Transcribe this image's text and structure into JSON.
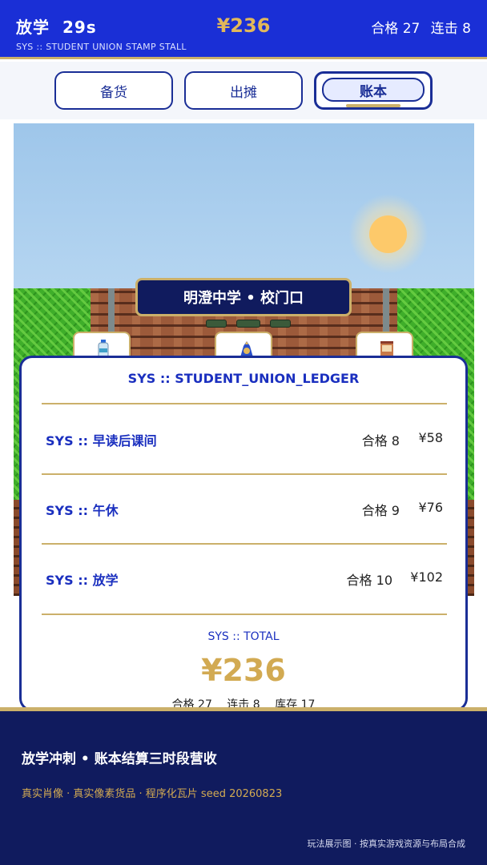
{
  "hud": {
    "period": "放学",
    "time": "29s",
    "subtitle": "SYS :: STUDENT UNION STAMP STALL",
    "money": "¥236",
    "pass_label": "合格 27",
    "combo_label": "连击 8"
  },
  "tabs": [
    {
      "label": "备货",
      "active": false
    },
    {
      "label": "出摊",
      "active": false
    },
    {
      "label": "账本",
      "active": true
    }
  ],
  "scene": {
    "gate_sign": "明澄中学 • 校门口",
    "items": [
      "water-bottle-icon",
      "bread-bag-icon",
      "snack-bag-icon"
    ]
  },
  "ledger": {
    "title": "SYS :: STUDENT_UNION_LEDGER",
    "rows": [
      {
        "name": "SYS :: 早读后课间",
        "pass": "合格 8",
        "amount": "¥58"
      },
      {
        "name": "SYS :: 午休",
        "pass": "合格 9",
        "amount": "¥76"
      },
      {
        "name": "SYS :: 放学",
        "pass": "合格 10",
        "amount": "¥102"
      }
    ],
    "total_label": "SYS :: TOTAL",
    "total_amount": "¥236",
    "total_pass": "合格 27",
    "total_combo": "连击 8",
    "total_stock": "库存 17"
  },
  "footer": {
    "title": "放学冲刺 • 账本结算三时段营收",
    "credits": "真实肖像 · 真实像素货品 · 程序化瓦片 seed 20260823",
    "note": "玩法展示图 · 按真实游戏资源与布局合成"
  },
  "colors": {
    "header_blue": "#1a2fd6",
    "navy": "#101b5e",
    "gold": "#cbb06a",
    "money_gold": "#e2b85a",
    "accent_blue": "#1a2fbf"
  }
}
